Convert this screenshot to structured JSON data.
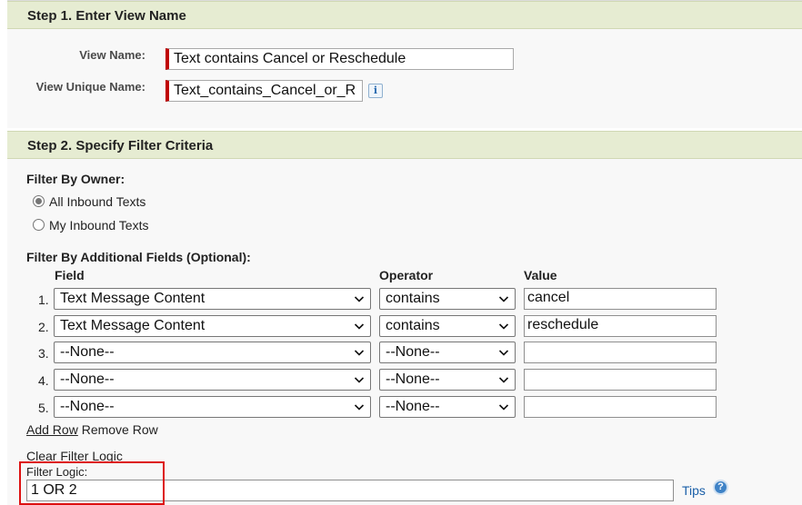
{
  "step1": {
    "title": "Step 1. Enter View Name",
    "view_name_label": "View Name:",
    "view_name_value": "Text contains Cancel or Reschedule",
    "unique_name_label": "View Unique Name:",
    "unique_name_value": "Text_contains_Cancel_or_R",
    "info_glyph": "i"
  },
  "step2": {
    "title": "Step 2. Specify Filter Criteria",
    "filter_by_owner_label": "Filter By Owner:",
    "owner_options": [
      {
        "label": "All Inbound Texts",
        "selected": true
      },
      {
        "label": "My Inbound Texts",
        "selected": false
      }
    ],
    "additional_label": "Filter By Additional Fields (Optional):",
    "columns": {
      "field": "Field",
      "operator": "Operator",
      "value": "Value"
    },
    "rows": [
      {
        "num": "1.",
        "field": "Text Message Content",
        "operator": "contains",
        "value": "cancel"
      },
      {
        "num": "2.",
        "field": "Text Message Content",
        "operator": "contains",
        "value": "reschedule"
      },
      {
        "num": "3.",
        "field": "--None--",
        "operator": "--None--",
        "value": ""
      },
      {
        "num": "4.",
        "field": "--None--",
        "operator": "--None--",
        "value": ""
      },
      {
        "num": "5.",
        "field": "--None--",
        "operator": "--None--",
        "value": ""
      }
    ],
    "add_row": "Add Row",
    "remove_row": "Remove Row",
    "clear_filter_logic": "Clear Filter Logic",
    "filter_logic_label": "Filter Logic:",
    "filter_logic_value": "1 OR 2",
    "tips": "Tips",
    "help_glyph": "?"
  },
  "colors": {
    "header_bg": "#e6ecd2",
    "required_bar": "#c00000",
    "highlight": "#dd1111",
    "link": "#1a5fa8"
  }
}
